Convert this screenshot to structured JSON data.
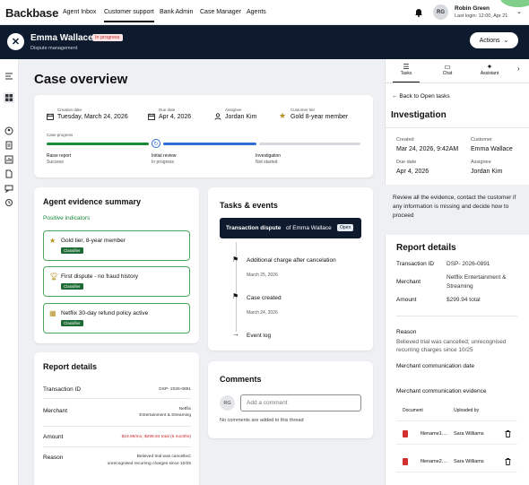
{
  "topnav": {
    "brand": "Backbase",
    "tabs": [
      "Agent Inbox",
      "Customer support",
      "Bank Admin",
      "Case Manager",
      "Agents"
    ],
    "active_tab": "Customer support",
    "user": {
      "initials": "RG",
      "name": "Robin Green",
      "last_login": "Last login: 12:00, Apr 21"
    }
  },
  "header": {
    "name": "Emma Wallace",
    "status": "In progress",
    "subtitle": "Dispute management",
    "actions_label": "Actions"
  },
  "overview": {
    "title": "Case overview",
    "fields": [
      {
        "label": "Creation date",
        "value": "Tuesday, March 24, 2026",
        "icon": "calendar-icon"
      },
      {
        "label": "Due date",
        "value": "Apr 4, 2026",
        "icon": "calendar-icon"
      },
      {
        "label": "Assignee",
        "value": "Jordan Kim",
        "icon": "person-icon"
      },
      {
        "label": "Customer tier",
        "value": "Gold 8-year member",
        "icon": "star-icon"
      }
    ],
    "progress_label": "Case progress",
    "steps": [
      {
        "title": "Raise report",
        "status": "Success"
      },
      {
        "title": "Initial review",
        "status": "In progress"
      },
      {
        "title": "Investigation",
        "status": "Not started"
      }
    ]
  },
  "evidence": {
    "title": "Agent evidence summary",
    "positive_label": "Positive indicators",
    "items": [
      {
        "text": "Gold tier, 8-year member",
        "tag": "Classifier",
        "icon": "star-icon"
      },
      {
        "text": "First dispute - no fraud history",
        "tag": "Classifier",
        "icon": "trophy-icon"
      },
      {
        "text": "Netflix 30-day refund policy active",
        "tag": "Classifier",
        "icon": "calendar-check-icon"
      }
    ]
  },
  "tasks": {
    "title": "Tasks & events",
    "current_task_title": "Transaction dispute",
    "current_task_of": "of Emma Wallace",
    "current_task_badge": "Open",
    "events": [
      {
        "title": "Additional charge after cancelation",
        "date": "March 25, 2026"
      },
      {
        "title": "Case created",
        "date": "March 24, 2026"
      }
    ],
    "event_log_label": "Event log"
  },
  "report_left": {
    "title": "Report details",
    "rows": [
      {
        "label": "Transaction ID",
        "value": "DSP- 2026-0891"
      },
      {
        "label": "Merchant",
        "value_line1": "Netflix",
        "value_line2": "Entertainment & Streaming"
      },
      {
        "label": "Amount",
        "value": "$19.99/mo; $299.94 total (6 months)"
      },
      {
        "label": "Reason",
        "value_line1": "Believed trial was cancelled;",
        "value_line2": "unrecognised recurring charges since 10/25"
      }
    ]
  },
  "comments": {
    "title": "Comments",
    "avatar": "RG",
    "placeholder": "Add a comment",
    "empty_text": "No comments are added to this thread"
  },
  "right_panel": {
    "tabs": [
      "Tasks",
      "Chat",
      "Assistant"
    ],
    "back_label": "Back to Open tasks",
    "task_title": "Investigation",
    "created_label": "Created",
    "created_value": "Mar 24, 2026, 9:42AM",
    "customer_label": "Customer",
    "customer_value": "Emma Wallace",
    "due_label": "Due date",
    "due_value": "Apr 4, 2026",
    "assignee_label": "Assignee",
    "assignee_value": "Jordan Kim",
    "instructions": "Review all the evidence, contact the customer if any information is missing and decide how to proceed",
    "report_title": "Report details",
    "transaction_label": "Transaction ID",
    "transaction_value": "DSP- 2026-0891",
    "merchant_label": "Merchant",
    "merchant_value": "Netflix Entertainment & Streaming",
    "amount_label": "Amount",
    "amount_value": "$299.94 total",
    "reason_label": "Reason",
    "reason_value": "Believed trial was cancelled; unrecognised recurring charges since 10/25",
    "merchant_comm_label": "Merchant communication date",
    "merchant_comm_evidence_label": "Merchant communication evidence",
    "doc_header": "Document",
    "uploaded_header": "Uploaded by",
    "documents": [
      {
        "name": "filename1....",
        "uploaded_by": "Sara Williams"
      },
      {
        "name": "filename2....",
        "uploaded_by": "Sara Williams"
      }
    ]
  },
  "colors": {
    "header_bg": "#0e1b2e",
    "success": "#1b8a3a",
    "accent_blue": "#2e6fd6",
    "badge_red": "#c62828"
  }
}
